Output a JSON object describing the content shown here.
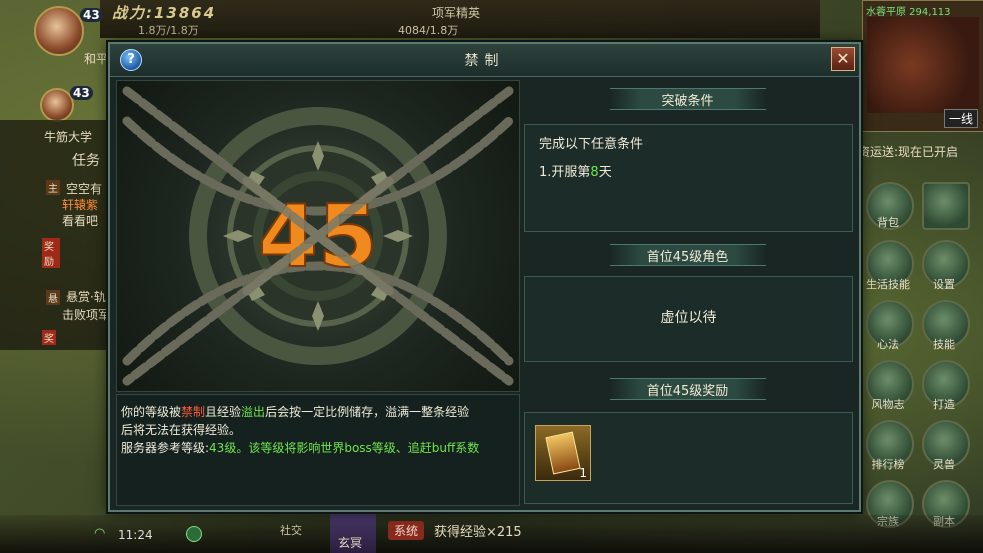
{
  "hud": {
    "power": "战力:13864",
    "hp1": "1.8万/1.8万",
    "hp2": "4084/1.8万",
    "top_title": "项军精英",
    "player_level": "43",
    "player_name": "和平",
    "pet_level": "43",
    "guild": "牛筋大学",
    "task_label": "任务",
    "left_lines": [
      "空空有",
      "轩辕紫",
      "看看吧",
      "悬赏·轨",
      "击败项军"
    ],
    "left_badges": [
      "主",
      "奖励",
      "悬",
      "奖"
    ]
  },
  "minimap": {
    "title": "水蓉平原 294,113",
    "button": "一线"
  },
  "right_notice": "资运送:现在已开启",
  "side_buttons": [
    "背包",
    "生活技能",
    "设置",
    "心法",
    "技能",
    "风物志",
    "打造",
    "排行榜",
    "灵兽",
    "宗族",
    "副本"
  ],
  "bottom": {
    "time": "11:24",
    "social": "社交",
    "xuanming": "玄冥",
    "sys_badge": "系统",
    "sys_msg": "获得经验×215"
  },
  "dialog": {
    "title": "禁制",
    "art_level": "45",
    "desc": {
      "line1_pre": "你的等级被",
      "line1_hl1": "禁制",
      "line1_mid": "且经验",
      "line1_hl2": "溢出",
      "line1_post": "后会按一定比例储存，溢满一整条经验",
      "line2": "后将无法在获得经验。",
      "line3_pre": "服务器参考等级:",
      "line3_lvl": "43",
      "line3_post": "级。该等级将影响世界boss等级、追赶buff系数"
    },
    "section1": {
      "header": "突破条件",
      "title": "完成以下任意条件",
      "item_pre": "1.开服第",
      "item_num": "8",
      "item_post": "天"
    },
    "section2": {
      "header": "首位45级角色",
      "body": "虚位以待"
    },
    "section3": {
      "header": "首位45级奖励",
      "reward_count": "1"
    }
  }
}
